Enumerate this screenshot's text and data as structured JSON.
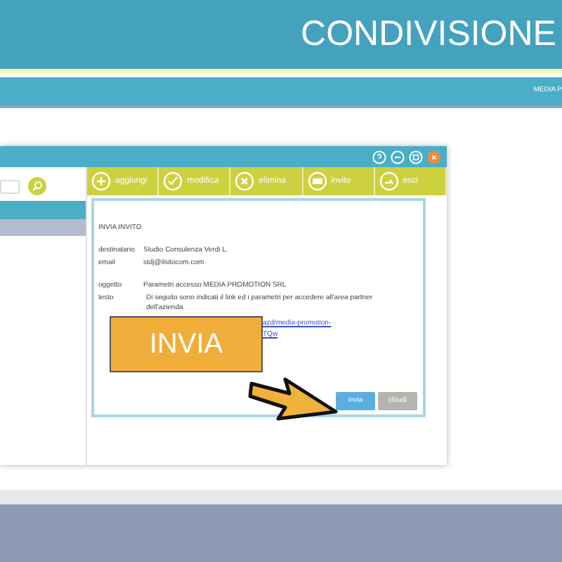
{
  "header": {
    "title": "CONDIVISIONE"
  },
  "nav": {
    "text": "MEDIA P"
  },
  "window": {
    "controls": [
      {
        "kind": "help"
      },
      {
        "kind": "minimize"
      },
      {
        "kind": "maximize"
      },
      {
        "kind": "close"
      }
    ]
  },
  "sidebar": {
    "rows": [
      {
        "selected": true
      },
      {
        "selected": false
      }
    ]
  },
  "toolbar": [
    {
      "kind": "add",
      "label": "aggiungi"
    },
    {
      "kind": "edit",
      "label": "modifica"
    },
    {
      "kind": "delete",
      "label": "elimina"
    },
    {
      "kind": "invite",
      "label": "invito"
    },
    {
      "kind": "exit",
      "label": "esci"
    }
  ],
  "dialog": {
    "heading": "INVIA INVITO",
    "fields": [
      {
        "label": "destinatario",
        "value": "Studio Consulenza Verdi L."
      },
      {
        "label": "email",
        "value": "stdj@ilsitocom.com"
      },
      {
        "label": "oggetto",
        "value": "Parametri accesso MEDIA PROMOTION SRL"
      },
      {
        "label": "testo",
        "value": "Di seguito sono indicati il link ed i parametri per accedere all'area partner dell'azienda"
      }
    ],
    "link_lines": [
      "azd/media-promotion-",
      "TQw"
    ],
    "buttons": [
      {
        "label": "invia",
        "kind": "primary"
      },
      {
        "label": "chiudi",
        "kind": "secondary"
      }
    ]
  },
  "callout": {
    "label": "INVIA"
  }
}
